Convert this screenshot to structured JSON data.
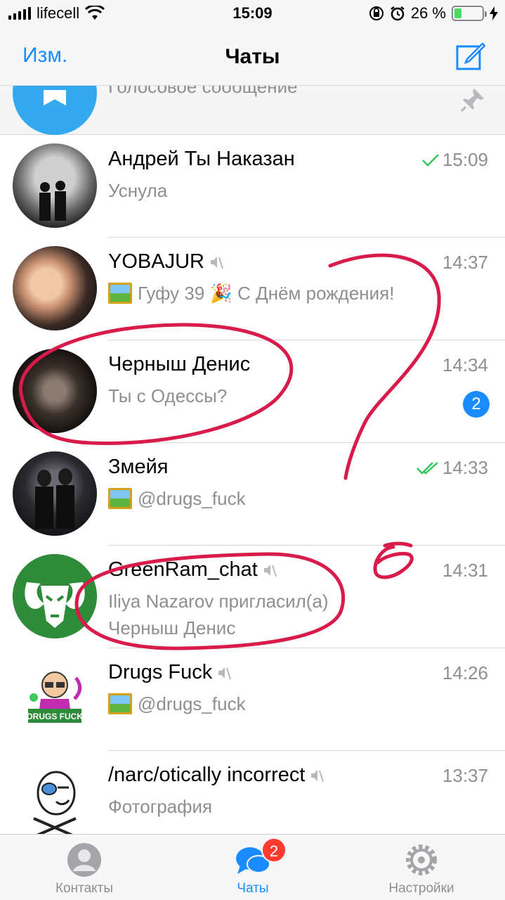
{
  "status_bar": {
    "carrier": "lifecell",
    "time": "15:09",
    "battery_percent": "26 %",
    "battery_level": 0.26
  },
  "nav": {
    "edit_label": "Изм.",
    "title": "Чаты",
    "compose_icon": "compose-icon"
  },
  "pinned": {
    "preview": "Голосовое сообщение"
  },
  "chats": [
    {
      "name": "Андрей Ты Наказан",
      "time": "15:09",
      "message": "Уснула",
      "status": "read-single",
      "muted": false
    },
    {
      "name": "YOBAJUR",
      "time": "14:37",
      "message": "Гуфу 39 🎉 С Днём рождения!",
      "muted": true,
      "has_photo": true
    },
    {
      "name": "Черныш Денис",
      "time": "14:34",
      "message": "Ты с Одессы?",
      "muted": false,
      "unread": "2"
    },
    {
      "name": "Змейя",
      "time": "14:33",
      "message": "@drugs_fuck",
      "status": "read-double",
      "has_photo": true,
      "muted": false
    },
    {
      "name": "GreenRam_chat",
      "time": "14:31",
      "message_line1": "Iliya Nazarov пригласил(а)",
      "message_line2": "Черныш Денис",
      "muted": true
    },
    {
      "name": "Drugs Fuck",
      "time": "14:26",
      "message": "@drugs_fuck",
      "muted": true,
      "has_photo": true
    },
    {
      "name": "/narc/otically incorrect",
      "time": "13:37",
      "message": "Фотография",
      "muted": true
    }
  ],
  "tabs": [
    {
      "label": "Контакты",
      "icon": "contacts-icon"
    },
    {
      "label": "Чаты",
      "icon": "chats-icon",
      "badge": "2"
    },
    {
      "label": "Настройки",
      "icon": "settings-icon"
    }
  ],
  "annotation": {
    "handwritten_mark": "б",
    "color": "#d81b4a"
  },
  "colors": {
    "accent": "#1a8cff",
    "read_check": "#34c759",
    "badge": "#ff3b30"
  }
}
